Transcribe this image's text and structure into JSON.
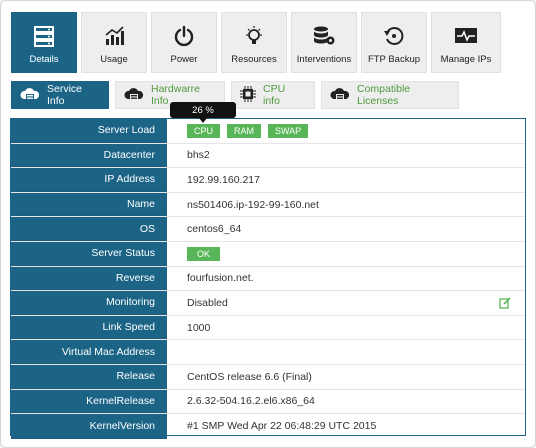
{
  "top_tabs": [
    {
      "label": "Details",
      "icon": "server-icon",
      "active": true
    },
    {
      "label": "Usage",
      "icon": "chart-icon",
      "active": false
    },
    {
      "label": "Power",
      "icon": "power-icon",
      "active": false
    },
    {
      "label": "Resources",
      "icon": "bulb-icon",
      "active": false
    },
    {
      "label": "Interventions",
      "icon": "database-gear-icon",
      "active": false
    },
    {
      "label": "FTP Backup",
      "icon": "restore-icon",
      "active": false
    },
    {
      "label": "Manage IPs",
      "icon": "monitor-pulse-icon",
      "active": false
    }
  ],
  "sub_tabs": [
    {
      "label": "Service Info",
      "active": true
    },
    {
      "label": "Hardwarre Info",
      "active": false
    },
    {
      "label": "CPU info",
      "active": false
    },
    {
      "label": "Compatible Licenses",
      "active": false
    }
  ],
  "tooltip": "26 %",
  "server_load_pills": [
    "CPU",
    "RAM",
    "SWAP"
  ],
  "status_badge": "OK",
  "colors": {
    "accent": "#1b6486",
    "green": "#58b658",
    "tab_green": "#4f9a3c"
  },
  "rows": [
    {
      "label": "Server Load",
      "value": ""
    },
    {
      "label": "Datacenter",
      "value": "bhs2"
    },
    {
      "label": "IP Address",
      "value": "192.99.160.217"
    },
    {
      "label": "Name",
      "value": "ns501406.ip-192-99-160.net"
    },
    {
      "label": "OS",
      "value": "centos6_64"
    },
    {
      "label": "Server Status",
      "value": ""
    },
    {
      "label": "Reverse",
      "value": "fourfusion.net."
    },
    {
      "label": "Monitoring",
      "value": "Disabled"
    },
    {
      "label": "Link Speed",
      "value": "1000"
    },
    {
      "label": "Virtual Mac Address",
      "value": ""
    },
    {
      "label": "Release",
      "value": "CentOS release 6.6 (Final)"
    },
    {
      "label": "KernelRelease",
      "value": "2.6.32-504.16.2.el6.x86_64"
    },
    {
      "label": "KernelVersion",
      "value": "#1 SMP Wed Apr 22 06:48:29 UTC 2015"
    }
  ]
}
